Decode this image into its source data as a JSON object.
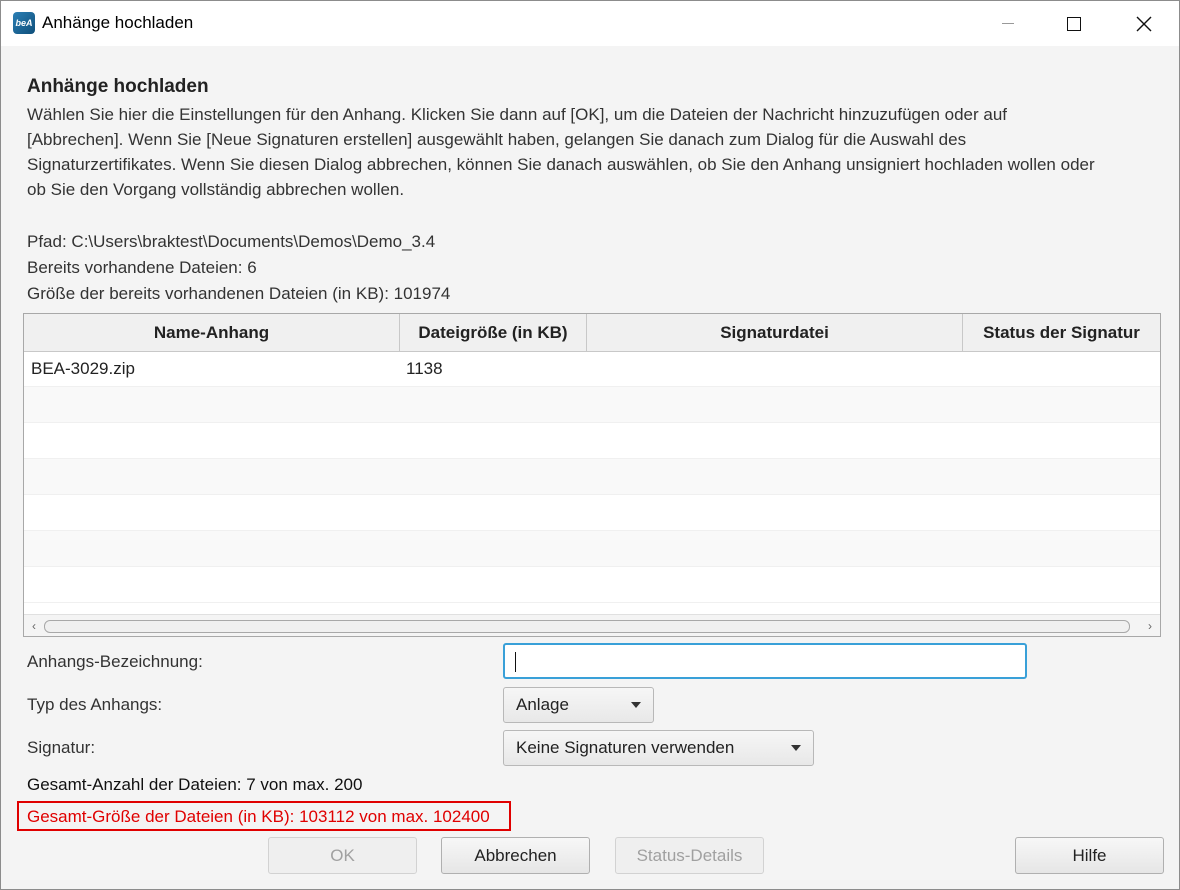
{
  "window": {
    "title": "Anhänge hochladen",
    "icon_text": "beA"
  },
  "dialog": {
    "heading": "Anhänge hochladen",
    "description_lines": [
      "Wählen Sie hier die Einstellungen für den Anhang. Klicken Sie dann auf [OK], um die Dateien der Nachricht hinzuzufügen oder auf",
      "[Abbrechen]. Wenn Sie [Neue Signaturen erstellen] ausgewählt haben, gelangen Sie danach zum Dialog für die Auswahl des",
      "Signaturzertifikates. Wenn Sie diesen Dialog abbrechen, können Sie danach auswählen, ob Sie den Anhang unsigniert hochladen wollen oder",
      "ob Sie den Vorgang vollständig abbrechen wollen."
    ],
    "path": "Pfad: C:\\Users\\braktest\\Documents\\Demos\\Demo_3.4",
    "existing_files": "Bereits vorhandene Dateien: 6",
    "existing_size": "Größe der bereits vorhandenen Dateien (in KB): 101974"
  },
  "table": {
    "columns": [
      "Name-Anhang",
      "Dateigröße (in KB)",
      "Signaturdatei",
      "Status der Signatur"
    ],
    "rows": [
      [
        "BEA-3029.zip",
        "1138",
        "",
        ""
      ]
    ]
  },
  "form": {
    "name_label": "Anhangs-Bezeichnung:",
    "name_value": "",
    "type_label": "Typ des Anhangs:",
    "type_value": "Anlage",
    "signature_label": "Signatur:",
    "signature_value": "Keine Signaturen verwenden"
  },
  "summary": {
    "total_count": "Gesamt-Anzahl der Dateien: 7 von max. 200",
    "total_size_error": "Gesamt-Größe der Dateien (in KB): 103112 von max. 102400"
  },
  "buttons": {
    "ok": "OK",
    "cancel": "Abbrechen",
    "status_details": "Status-Details",
    "help": "Hilfe"
  },
  "icons": {
    "app": "bea-app-icon",
    "minimize": "minimize-icon",
    "maximize": "maximize-icon",
    "close": "close-icon"
  },
  "colors": {
    "error": "#e00000",
    "focus": "#39a0d8"
  }
}
